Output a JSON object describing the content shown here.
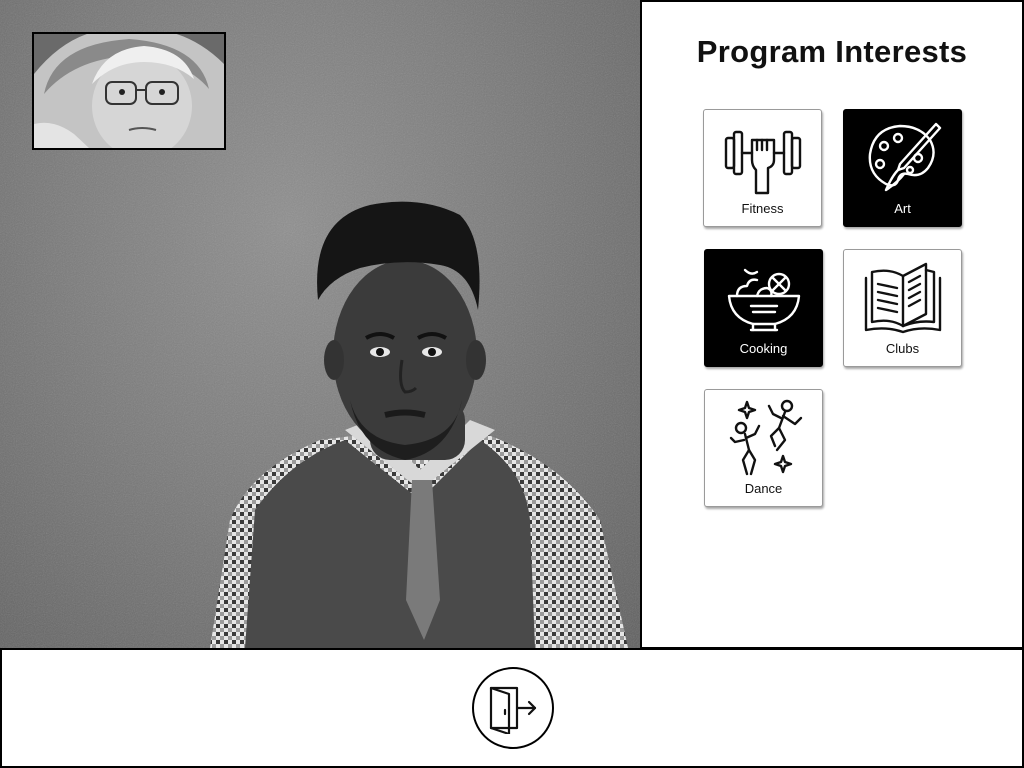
{
  "panel": {
    "title": "Program Interests",
    "tiles": [
      {
        "label": "Fitness",
        "icon": "dumbbell-icon",
        "selected": false
      },
      {
        "label": "Art",
        "icon": "palette-icon",
        "selected": true
      },
      {
        "label": "Cooking",
        "icon": "salad-bowl-icon",
        "selected": true
      },
      {
        "label": "Clubs",
        "icon": "open-book-icon",
        "selected": false
      },
      {
        "label": "Dance",
        "icon": "dancers-icon",
        "selected": false
      }
    ]
  },
  "video": {
    "main_feed": "remote-participant",
    "self_view": "local-participant"
  },
  "controls": {
    "exit_icon": "exit-door-icon"
  },
  "colors": {
    "selected_tile_bg": "#000000",
    "tile_bg": "#ffffff",
    "border": "#000000"
  }
}
